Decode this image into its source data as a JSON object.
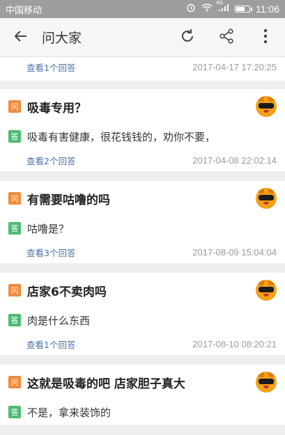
{
  "status_bar": {
    "carrier": "中国移动",
    "network": "4G",
    "time": "11:06",
    "battery_level": 0.7
  },
  "app_bar": {
    "title": "问大家",
    "back_icon": "arrow-left-icon",
    "refresh_icon": "refresh-icon",
    "share_icon": "share-icon",
    "more_icon": "more-vert-icon"
  },
  "badges": {
    "question": "问",
    "answer": "答"
  },
  "colors": {
    "question_badge": "#f08a3c",
    "answer_badge": "#4cbb74",
    "link": "#4a6fa5"
  },
  "partial_item": {
    "view_link": "查看1个回答",
    "timestamp": "2017-04-17 17:20:25"
  },
  "items": [
    {
      "question": "吸毒专用？",
      "answer": "吸毒有害健康，很花钱钱的，劝你不要，",
      "view_link": "查看2个回答",
      "timestamp": "2017-04-08 22:02:14"
    },
    {
      "question": "有需要咕噜的吗",
      "answer": "咕噜是？",
      "view_link": "查看3个回答",
      "timestamp": "2017-08-09 15:04:04"
    },
    {
      "question": "店家6不卖肉吗",
      "answer": "肉是什么东西",
      "view_link": "查看1个回答",
      "timestamp": "2017-08-10 08:20:21"
    },
    {
      "question": "这就是吸毒的吧 店家胆子真大",
      "answer": "不是，拿来装饰的",
      "view_link": "",
      "timestamp": ""
    }
  ]
}
